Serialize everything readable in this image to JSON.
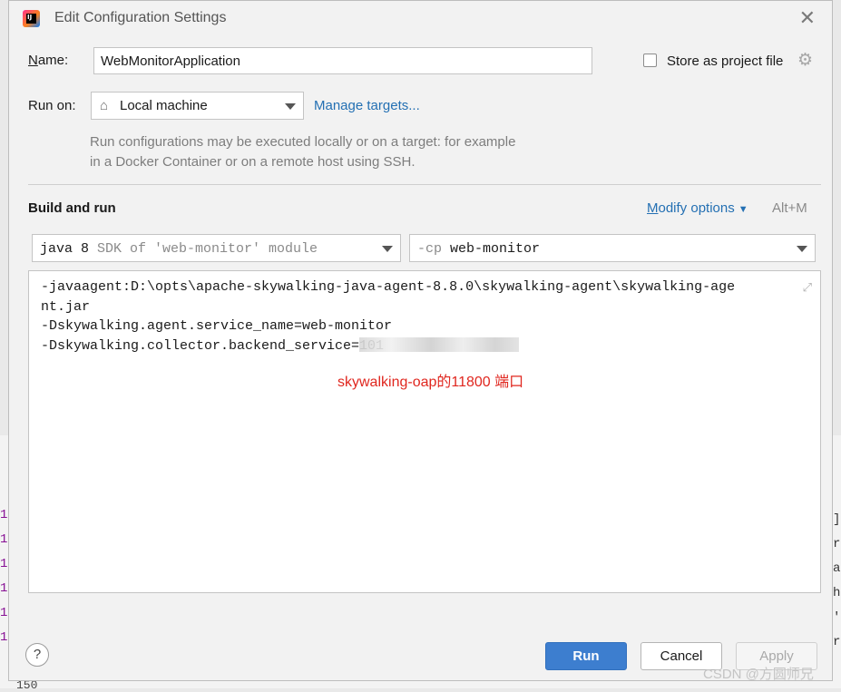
{
  "background": {
    "gutter": [
      "1",
      "1",
      "1",
      "1",
      "1",
      "1"
    ],
    "right_edge": [
      "]",
      "r",
      "a",
      "h",
      "'",
      "r"
    ],
    "bottom_fragment": "150"
  },
  "dialog": {
    "title": "Edit Configuration Settings",
    "app_icon_text": "IJ",
    "close_symbol": "✕"
  },
  "name": {
    "label_mnemonic": "N",
    "label_rest": "ame:",
    "value": "WebMonitorApplication"
  },
  "store_as_project_file": {
    "label": "Store as project file",
    "checked": false
  },
  "run_on": {
    "label": "Run on:",
    "value": "Local machine",
    "manage_targets": "Manage targets..."
  },
  "help_text": "Run configurations may be executed locally or on a target: for example in a Docker Container or on a remote host using SSH.",
  "build_and_run": {
    "title": "Build and run",
    "modify_mnemonic": "M",
    "modify_rest": "odify options",
    "shortcut": "Alt+M",
    "jdk_main": "java 8",
    "jdk_detail": " SDK of 'web-monitor' module",
    "cp_prefix": "-cp",
    "cp_value": " web-monitor"
  },
  "vm_options": {
    "lines": [
      "-javaagent:D:\\opts\\apache-skywalking-java-agent-8.8.0\\skywalking-agent\\skywalking-age",
      "nt.jar",
      "-Dskywalking.agent.service_name=web-monitor",
      "-Dskywalking.collector.backend_service=101"
    ],
    "annotation": "skywalking-oap的11800 端口"
  },
  "buttons": {
    "help": "?",
    "run": "Run",
    "cancel": "Cancel",
    "apply": "Apply"
  },
  "watermark": "CSDN @方圆师兄",
  "colors": {
    "accent": "#3d7ecf",
    "link": "#2470b3",
    "annotation": "#e0271f"
  },
  "icons": {
    "home": "home-icon",
    "gear": "gear-icon",
    "expand": "expand-icon",
    "dropdown": "chevron-down-icon"
  }
}
